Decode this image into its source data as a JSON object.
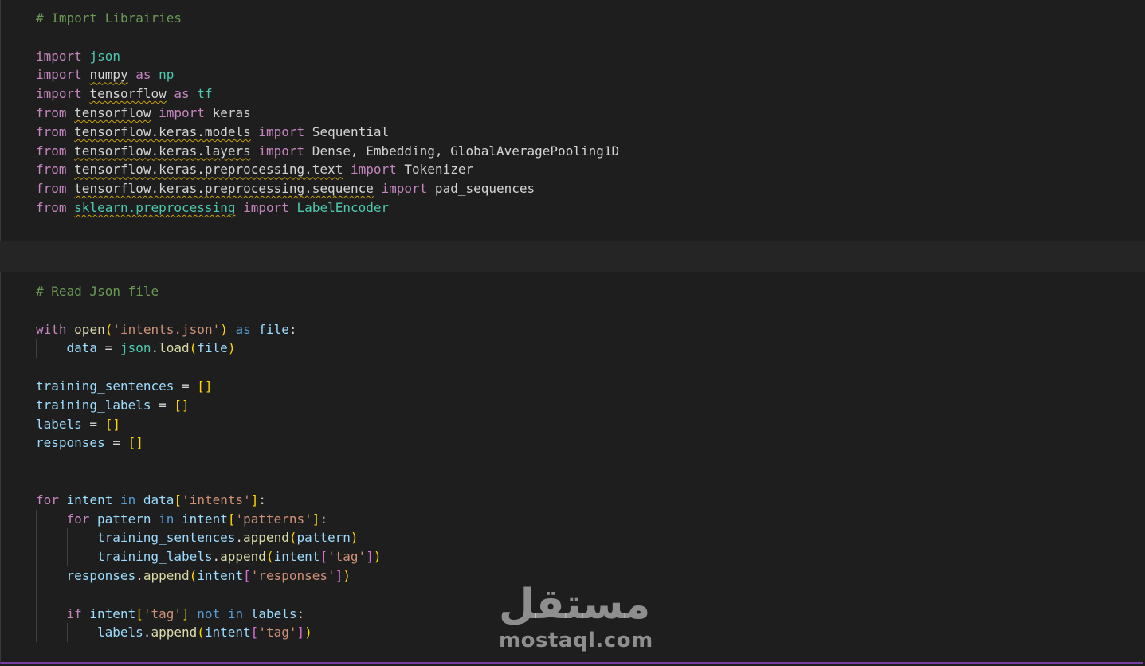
{
  "cells": [
    {
      "name": "imports-cell",
      "lines": [
        [
          {
            "t": "# Import Librairies",
            "c": "cm"
          }
        ],
        [],
        [
          {
            "t": "import",
            "c": "kw"
          },
          {
            "t": " "
          },
          {
            "t": "json",
            "c": "mod-lib"
          }
        ],
        [
          {
            "t": "import",
            "c": "kw"
          },
          {
            "t": " "
          },
          {
            "t": "numpy",
            "c": "mod",
            "w": true
          },
          {
            "t": " "
          },
          {
            "t": "as",
            "c": "kw"
          },
          {
            "t": " "
          },
          {
            "t": "np",
            "c": "mod-lib"
          }
        ],
        [
          {
            "t": "import",
            "c": "kw"
          },
          {
            "t": " "
          },
          {
            "t": "tensorflow",
            "c": "mod",
            "w": true
          },
          {
            "t": " "
          },
          {
            "t": "as",
            "c": "kw"
          },
          {
            "t": " "
          },
          {
            "t": "tf",
            "c": "cls"
          }
        ],
        [
          {
            "t": "from",
            "c": "kw"
          },
          {
            "t": " "
          },
          {
            "t": "tensorflow",
            "c": "mod",
            "w": true
          },
          {
            "t": " "
          },
          {
            "t": "import",
            "c": "kw"
          },
          {
            "t": " keras"
          }
        ],
        [
          {
            "t": "from",
            "c": "kw"
          },
          {
            "t": " "
          },
          {
            "t": "tensorflow.keras.models",
            "c": "mod",
            "w": true
          },
          {
            "t": " "
          },
          {
            "t": "import",
            "c": "kw"
          },
          {
            "t": " Sequential"
          }
        ],
        [
          {
            "t": "from",
            "c": "kw"
          },
          {
            "t": " "
          },
          {
            "t": "tensorflow.keras.layers",
            "c": "mod",
            "w": true
          },
          {
            "t": " "
          },
          {
            "t": "import",
            "c": "kw"
          },
          {
            "t": " Dense, Embedding, GlobalAveragePooling1D"
          }
        ],
        [
          {
            "t": "from",
            "c": "kw"
          },
          {
            "t": " "
          },
          {
            "t": "tensorflow.keras.preprocessing.text",
            "c": "mod",
            "w": true
          },
          {
            "t": " "
          },
          {
            "t": "import",
            "c": "kw"
          },
          {
            "t": " Tokenizer"
          }
        ],
        [
          {
            "t": "from",
            "c": "kw"
          },
          {
            "t": " "
          },
          {
            "t": "tensorflow.keras.preprocessing.sequence",
            "c": "mod",
            "w": true
          },
          {
            "t": " "
          },
          {
            "t": "import",
            "c": "kw"
          },
          {
            "t": " pad_sequences"
          }
        ],
        [
          {
            "t": "from",
            "c": "kw"
          },
          {
            "t": " "
          },
          {
            "t": "sklearn.preprocessing",
            "c": "mod-lib",
            "w": true
          },
          {
            "t": " "
          },
          {
            "t": "import",
            "c": "kw"
          },
          {
            "t": " "
          },
          {
            "t": "LabelEncoder",
            "c": "cls"
          }
        ]
      ]
    },
    {
      "name": "read-json-cell",
      "lines": [
        [
          {
            "t": "# Read Json file",
            "c": "cm"
          }
        ],
        [],
        [
          {
            "t": "with",
            "c": "kw"
          },
          {
            "t": " "
          },
          {
            "t": "open",
            "c": "fn"
          },
          {
            "t": "(",
            "c": "brk"
          },
          {
            "t": "'intents.json'",
            "c": "str"
          },
          {
            "t": ")",
            "c": "brk"
          },
          {
            "t": " "
          },
          {
            "t": "as",
            "c": "kb"
          },
          {
            "t": " "
          },
          {
            "t": "file",
            "c": "var"
          },
          {
            "t": ":"
          }
        ],
        [
          {
            "g": 1
          },
          {
            "t": "data",
            "c": "var"
          },
          {
            "t": " = "
          },
          {
            "t": "json",
            "c": "cls"
          },
          {
            "t": "."
          },
          {
            "t": "load",
            "c": "fn"
          },
          {
            "t": "(",
            "c": "brk"
          },
          {
            "t": "file",
            "c": "var"
          },
          {
            "t": ")",
            "c": "brk"
          }
        ],
        [],
        [
          {
            "t": "training_sentences",
            "c": "var"
          },
          {
            "t": " = "
          },
          {
            "t": "[]",
            "c": "brk"
          }
        ],
        [
          {
            "t": "training_labels",
            "c": "var"
          },
          {
            "t": " = "
          },
          {
            "t": "[]",
            "c": "brk"
          }
        ],
        [
          {
            "t": "labels",
            "c": "var"
          },
          {
            "t": " = "
          },
          {
            "t": "[]",
            "c": "brk"
          }
        ],
        [
          {
            "t": "responses",
            "c": "var"
          },
          {
            "t": " = "
          },
          {
            "t": "[]",
            "c": "brk"
          }
        ],
        [],
        [],
        [
          {
            "t": "for",
            "c": "kw"
          },
          {
            "t": " "
          },
          {
            "t": "intent",
            "c": "var"
          },
          {
            "t": " "
          },
          {
            "t": "in",
            "c": "kb"
          },
          {
            "t": " "
          },
          {
            "t": "data",
            "c": "var"
          },
          {
            "t": "[",
            "c": "brk"
          },
          {
            "t": "'intents'",
            "c": "str"
          },
          {
            "t": "]",
            "c": "brk"
          },
          {
            "t": ":"
          }
        ],
        [
          {
            "g": 1
          },
          {
            "t": "for",
            "c": "kw"
          },
          {
            "t": " "
          },
          {
            "t": "pattern",
            "c": "var"
          },
          {
            "t": " "
          },
          {
            "t": "in",
            "c": "kb"
          },
          {
            "t": " "
          },
          {
            "t": "intent",
            "c": "var"
          },
          {
            "t": "[",
            "c": "brk"
          },
          {
            "t": "'patterns'",
            "c": "str"
          },
          {
            "t": "]",
            "c": "brk"
          },
          {
            "t": ":"
          }
        ],
        [
          {
            "g": 2
          },
          {
            "t": "training_sentences",
            "c": "var"
          },
          {
            "t": "."
          },
          {
            "t": "append",
            "c": "fn"
          },
          {
            "t": "(",
            "c": "brk"
          },
          {
            "t": "pattern",
            "c": "var"
          },
          {
            "t": ")",
            "c": "brk"
          }
        ],
        [
          {
            "g": 2
          },
          {
            "t": "training_labels",
            "c": "var"
          },
          {
            "t": "."
          },
          {
            "t": "append",
            "c": "fn"
          },
          {
            "t": "(",
            "c": "brk"
          },
          {
            "t": "intent",
            "c": "var"
          },
          {
            "t": "[",
            "c": "brk2"
          },
          {
            "t": "'tag'",
            "c": "str"
          },
          {
            "t": "]",
            "c": "brk2"
          },
          {
            "t": ")",
            "c": "brk"
          }
        ],
        [
          {
            "g": 1
          },
          {
            "t": "responses",
            "c": "var"
          },
          {
            "t": "."
          },
          {
            "t": "append",
            "c": "fn"
          },
          {
            "t": "(",
            "c": "brk"
          },
          {
            "t": "intent",
            "c": "var"
          },
          {
            "t": "[",
            "c": "brk2"
          },
          {
            "t": "'responses'",
            "c": "str"
          },
          {
            "t": "]",
            "c": "brk2"
          },
          {
            "t": ")",
            "c": "brk"
          }
        ],
        [
          {
            "g": 1
          }
        ],
        [
          {
            "g": 1
          },
          {
            "t": "if",
            "c": "kw"
          },
          {
            "t": " "
          },
          {
            "t": "intent",
            "c": "var"
          },
          {
            "t": "[",
            "c": "brk"
          },
          {
            "t": "'tag'",
            "c": "str"
          },
          {
            "t": "]",
            "c": "brk"
          },
          {
            "t": " "
          },
          {
            "t": "not",
            "c": "kb"
          },
          {
            "t": " "
          },
          {
            "t": "in",
            "c": "kb"
          },
          {
            "t": " "
          },
          {
            "t": "labels",
            "c": "var"
          },
          {
            "t": ":"
          }
        ],
        [
          {
            "g": 2
          },
          {
            "t": "labels",
            "c": "var"
          },
          {
            "t": "."
          },
          {
            "t": "append",
            "c": "fn"
          },
          {
            "t": "(",
            "c": "brk"
          },
          {
            "t": "intent",
            "c": "var"
          },
          {
            "t": "[",
            "c": "brk2"
          },
          {
            "t": "'tag'",
            "c": "str"
          },
          {
            "t": "]",
            "c": "brk2"
          },
          {
            "t": ")",
            "c": "brk"
          }
        ]
      ]
    }
  ],
  "watermark": {
    "arabic": "مستقل",
    "latin": "mostaql.com"
  }
}
